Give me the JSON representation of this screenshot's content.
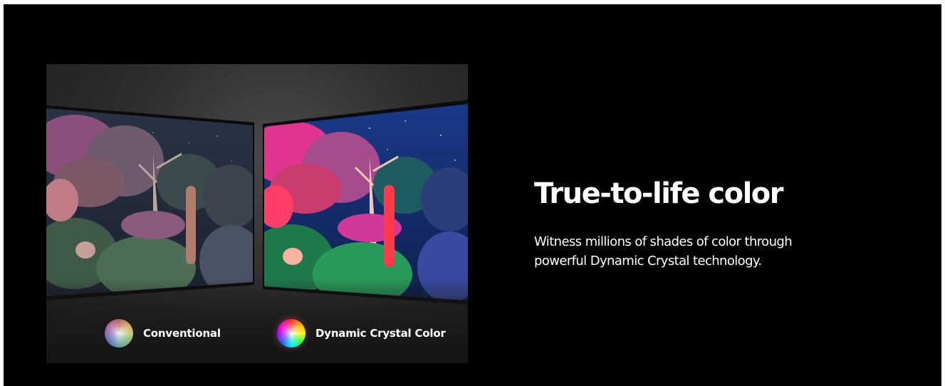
{
  "hero": {
    "headline": "True-to-life color",
    "description": "Witness millions of shades of color through powerful Dynamic Crystal technology."
  },
  "comparison": {
    "left_label": "Conventional",
    "right_label": "Dynamic Crystal Color"
  },
  "colors": {
    "background": "#000000",
    "text": "#ffffff"
  }
}
